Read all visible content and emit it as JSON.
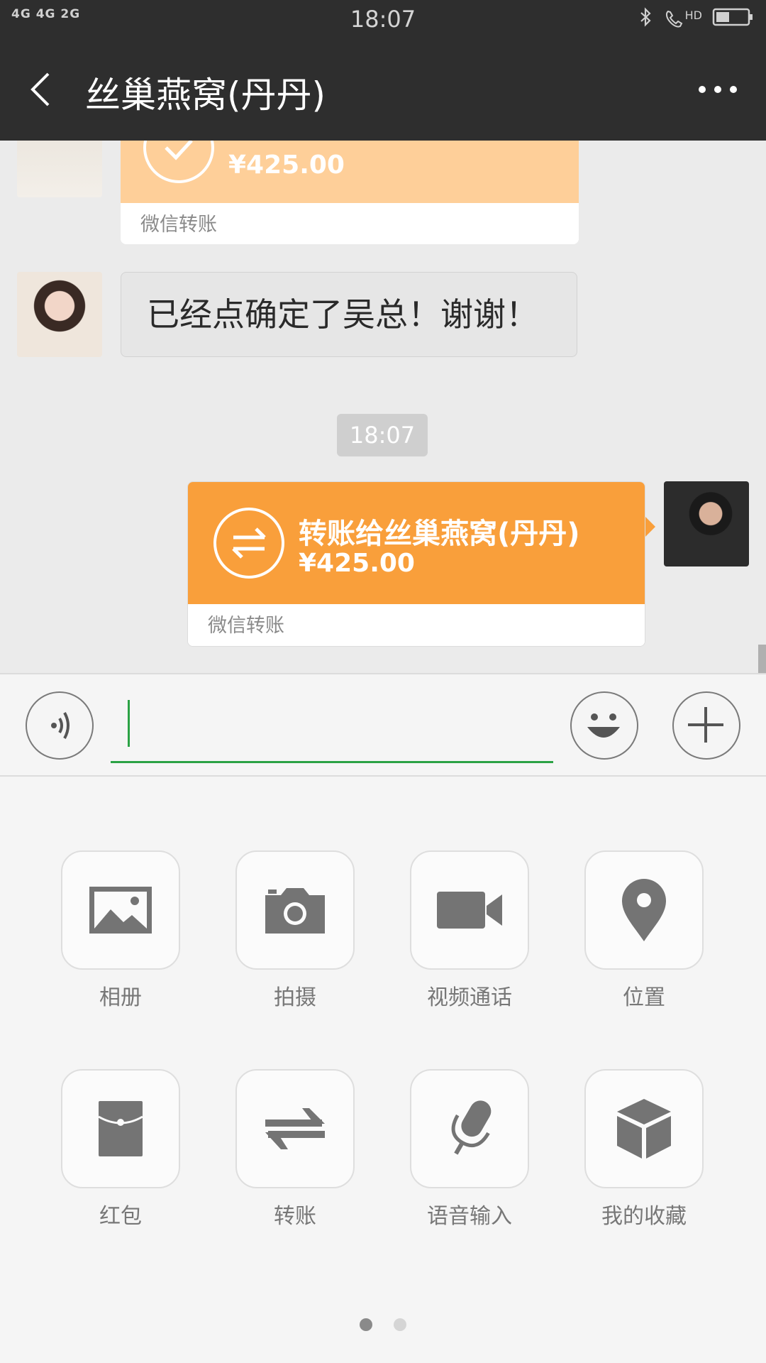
{
  "status_bar": {
    "network": "4G 4G 2G",
    "time": "18:07",
    "call_label": "HD"
  },
  "header": {
    "title": "丝巢燕窝(丹丹)"
  },
  "messages": [
    {
      "type": "transfer_received",
      "amount": "¥425.00",
      "source": "微信转账",
      "color": "#fecf99"
    },
    {
      "type": "text",
      "text": "已经点确定了吴总！谢谢！"
    },
    {
      "type": "timestamp",
      "text": "18:07"
    },
    {
      "type": "transfer_sent",
      "title": "转账给丝巢燕窝(丹丹)",
      "amount": "¥425.00",
      "source": "微信转账",
      "color": "#f99f3b"
    }
  ],
  "input_bar": {
    "cursor_color": "#2ba245"
  },
  "panel": {
    "items": [
      {
        "label": "相册",
        "icon": "album-icon"
      },
      {
        "label": "拍摄",
        "icon": "camera-icon"
      },
      {
        "label": "视频通话",
        "icon": "video-call-icon"
      },
      {
        "label": "位置",
        "icon": "location-icon"
      },
      {
        "label": "红包",
        "icon": "red-packet-icon"
      },
      {
        "label": "转账",
        "icon": "transfer-icon"
      },
      {
        "label": "语音输入",
        "icon": "voice-input-icon"
      },
      {
        "label": "我的收藏",
        "icon": "favorites-icon"
      }
    ],
    "page_indicator": {
      "current": 1,
      "total": 2
    }
  }
}
